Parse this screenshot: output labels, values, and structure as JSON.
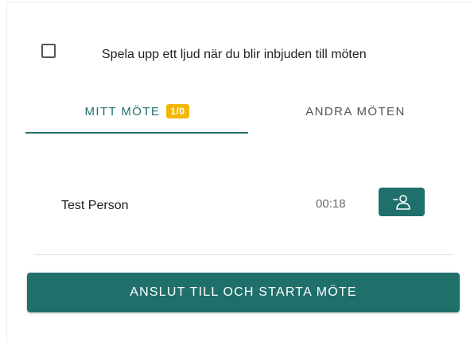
{
  "settings": {
    "sound_label": "Spela upp ett ljud när du blir inbjuden till möten",
    "sound_checked": false
  },
  "tabs": [
    {
      "label": "MITT MÖTE",
      "badge": "1/0",
      "active": true
    },
    {
      "label": "ANDRA MÖTEN",
      "active": false
    }
  ],
  "participants": [
    {
      "name": "Test Person",
      "time": "00:18",
      "action_icon": "person-minus-icon"
    }
  ],
  "join_button": {
    "label": "ANSLUT TILL OCH STARTA MÖTE"
  },
  "colors": {
    "primary": "#1f6f6b",
    "badge": "#f2b705",
    "text": "#222222",
    "muted": "#6b6b6b"
  }
}
